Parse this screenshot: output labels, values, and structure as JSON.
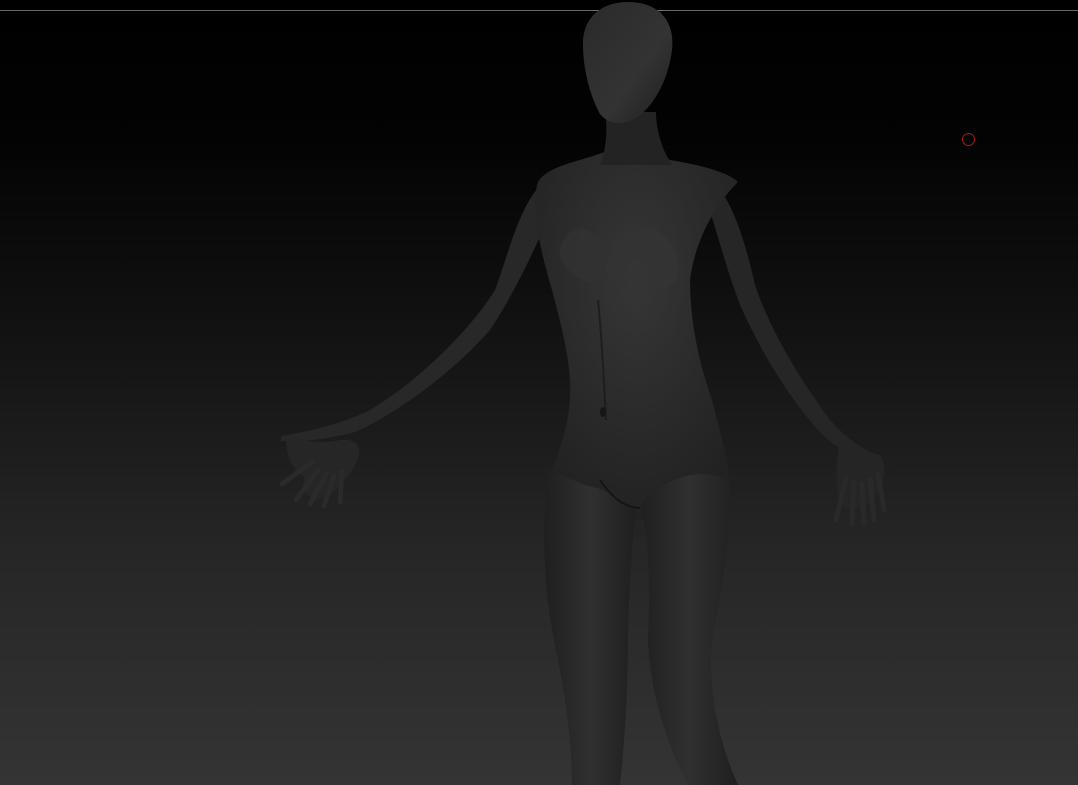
{
  "viewport": {
    "background_top": "#000000",
    "background_bottom": "#343434",
    "frame_line_color": "#6a6a6a"
  },
  "model": {
    "icon": "human-figure-base-mesh",
    "skin_color": "#2c2c2c",
    "shade_color": "#1c1c1c",
    "highlight_color": "#3e3e3e"
  },
  "cursor": {
    "icon": "brush-cursor-circle",
    "color": "#b01515"
  }
}
